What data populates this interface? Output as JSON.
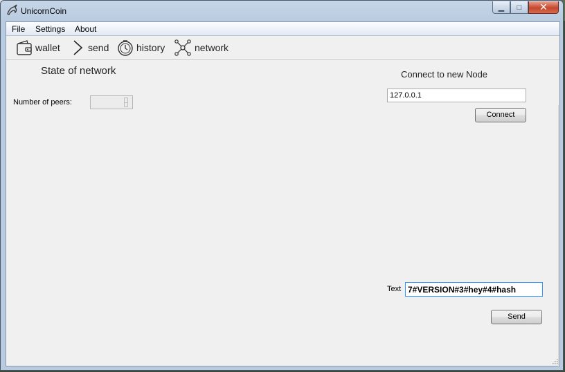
{
  "window": {
    "title": "UnicornCoin"
  },
  "menu": [
    {
      "label": "File"
    },
    {
      "label": "Settings"
    },
    {
      "label": "About"
    }
  ],
  "toolbar": [
    {
      "label": "wallet",
      "icon": "wallet-icon"
    },
    {
      "label": "send",
      "icon": "chevron-right-icon"
    },
    {
      "label": "history",
      "icon": "clock-icon"
    },
    {
      "label": "network",
      "icon": "network-icon"
    }
  ],
  "network": {
    "heading": "State of network",
    "peers_label": "Number of peers:",
    "peers_value": ""
  },
  "connect": {
    "heading": "Connect to new Node",
    "address_value": "127.0.0.1",
    "button_label": "Connect"
  },
  "message": {
    "text_label": "Text",
    "text_value": "7#VERSION#3#hey#4#hash",
    "send_label": "Send"
  }
}
